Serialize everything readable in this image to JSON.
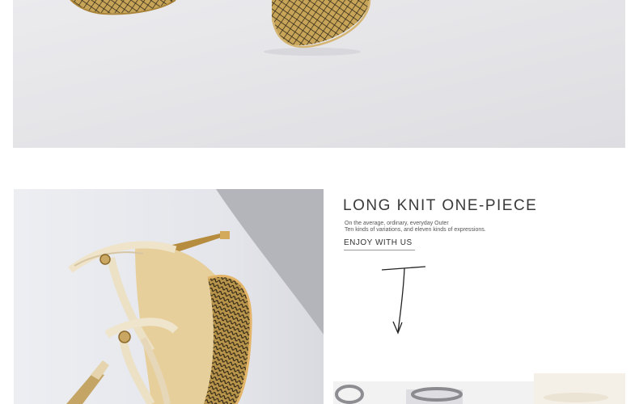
{
  "top_photo": {
    "alt": "gold snakeskin pointed-toe heels close-up"
  },
  "bottom_left_photo": {
    "alt": "gold and cream ankle-strap stiletto sandals"
  },
  "promo": {
    "headline": "LONG KNIT ONE-PIECE",
    "subline_1": "On the average, ordinary, everyday Outer",
    "subline_2": "Ten kinds of variations, and eleven kinds of expressions.",
    "enjoy_label": "ENJOY WITH US"
  },
  "colors": {
    "background": "#ffffff",
    "photo_bg": "#e6e6e9",
    "gold": "#b8944a",
    "cream": "#e9dcc0"
  }
}
